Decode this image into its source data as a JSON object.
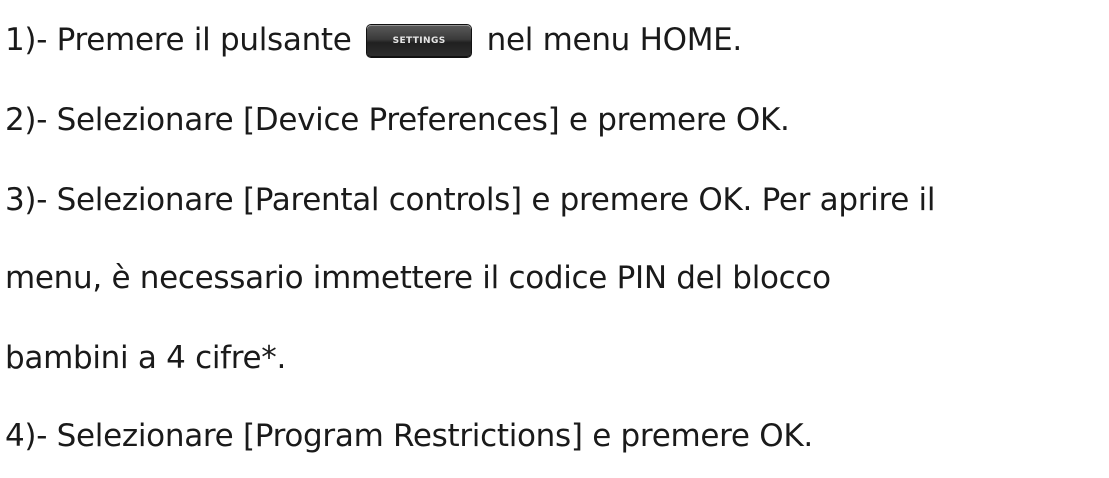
{
  "steps": {
    "s1": {
      "before": "1)- Premere il pulsante",
      "button_label": "SETTINGS",
      "after": "nel menu HOME."
    },
    "s2": "2)- Selezionare [Device Preferences] e premere OK.",
    "s3_line1": "3)- Selezionare [Parental controls] e premere OK. Per aprire il",
    "s3_line2": "menu, è necessario immettere il codice PIN del blocco",
    "s3_line3": "bambini a 4 cifre*.",
    "s4": "4)- Selezionare [Program Restrictions] e premere OK."
  }
}
